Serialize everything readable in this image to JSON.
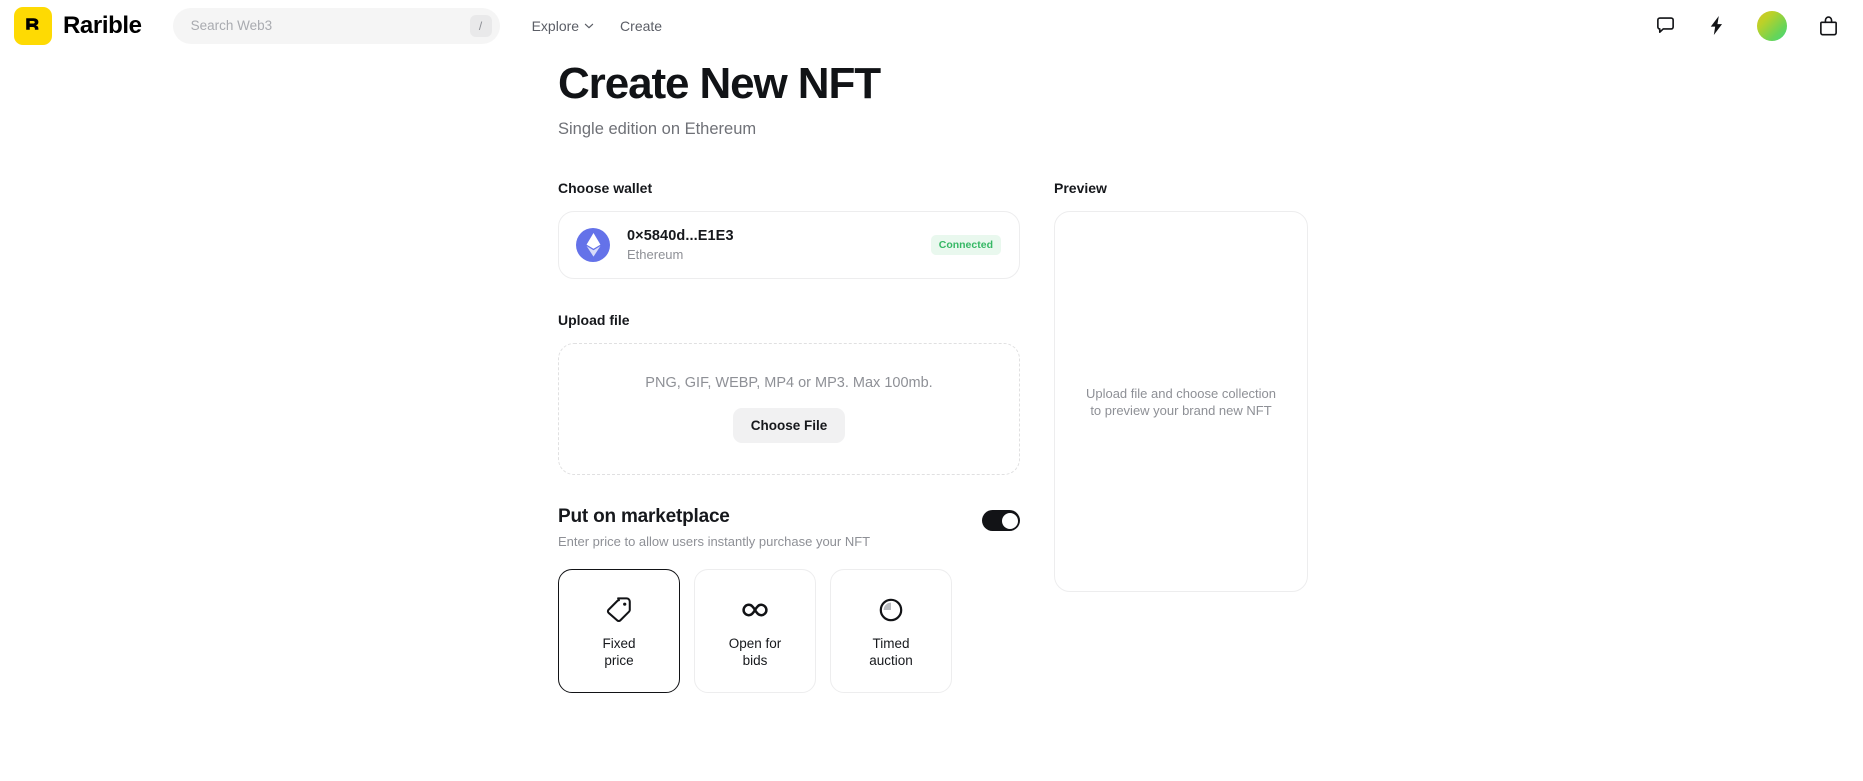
{
  "header": {
    "brand_name": "Rarible",
    "brand_mark_letter": "R",
    "brand_color": "#FEDA03",
    "search": {
      "placeholder": "Search Web3",
      "value": "",
      "shortcut_key": "/"
    },
    "nav": [
      {
        "label": "Explore",
        "has_chevron": true
      },
      {
        "label": "Create",
        "has_chevron": false
      }
    ],
    "icons": [
      {
        "name": "chat-bubble-icon"
      },
      {
        "name": "lightning-bolt-icon"
      },
      {
        "name": "avatar",
        "gradient_from": "#d5c42a",
        "gradient_to": "#42d97e"
      },
      {
        "name": "shopping-bag-icon"
      }
    ]
  },
  "page": {
    "title": "Create New NFT",
    "subtitle": "Single edition on Ethereum"
  },
  "wallet": {
    "section_label": "Choose wallet",
    "address": "0×5840d...E1E3",
    "chain": "Ethereum",
    "status_badge": "Connected",
    "status_color": "#36b865",
    "status_bg": "#e9f8ee",
    "chain_icon": "ethereum-icon",
    "chain_icon_bg": "#6472E9"
  },
  "upload": {
    "section_label": "Upload file",
    "hint": "PNG, GIF, WEBP, MP4 or MP3. Max 100mb.",
    "button_label": "Choose File"
  },
  "marketplace": {
    "title": "Put on marketplace",
    "subtitle": "Enter price to allow users instantly purchase your NFT",
    "toggle_on": true,
    "options": [
      {
        "label": "Fixed\nprice",
        "label_line1": "Fixed",
        "label_line2": "price",
        "icon": "price-tag-icon",
        "selected": true
      },
      {
        "label": "Open for bids",
        "label_line1": "Open for",
        "label_line2": "bids",
        "icon": "infinity-icon",
        "selected": false
      },
      {
        "label": "Timed auction",
        "label_line1": "Timed",
        "label_line2": "auction",
        "icon": "timer-icon",
        "selected": false
      }
    ]
  },
  "preview": {
    "section_label": "Preview",
    "empty_text": "Upload file and choose collection to preview your brand new NFT"
  }
}
